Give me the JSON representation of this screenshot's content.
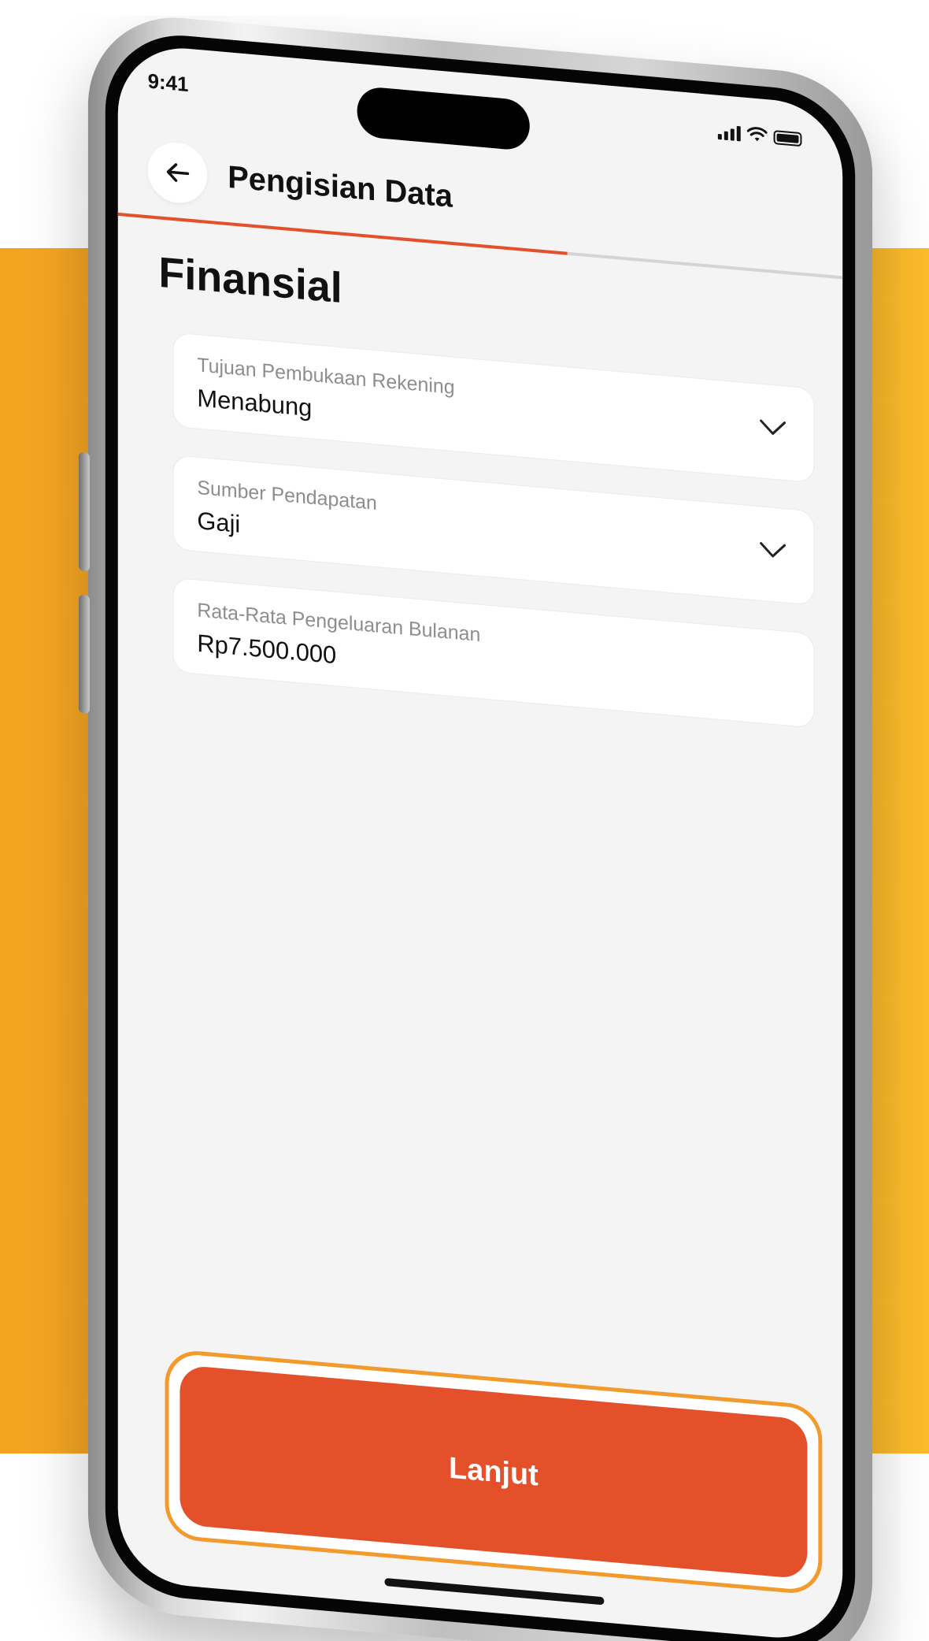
{
  "status_bar": {
    "time": "9:41"
  },
  "header": {
    "title": "Pengisian Data"
  },
  "progress": {
    "fraction": 0.62,
    "color": "#e4502a"
  },
  "section": {
    "title": "Finansial"
  },
  "fields": [
    {
      "label": "Tujuan Pembukaan Rekening",
      "value": "Menabung",
      "type": "dropdown"
    },
    {
      "label": "Sumber Pendapatan",
      "value": "Gaji",
      "type": "dropdown"
    },
    {
      "label": "Rata-Rata Pengeluaran Bulanan",
      "value": "Rp7.500.000",
      "type": "text"
    }
  ],
  "cta": {
    "label": "Lanjut"
  },
  "colors": {
    "accent": "#e4502a",
    "background_panel": "#f7ab24",
    "screen_bg": "#f4f4f4"
  },
  "icons": [
    "back-arrow-icon",
    "signal-icon",
    "wifi-icon",
    "battery-icon",
    "chevron-down-icon"
  ]
}
